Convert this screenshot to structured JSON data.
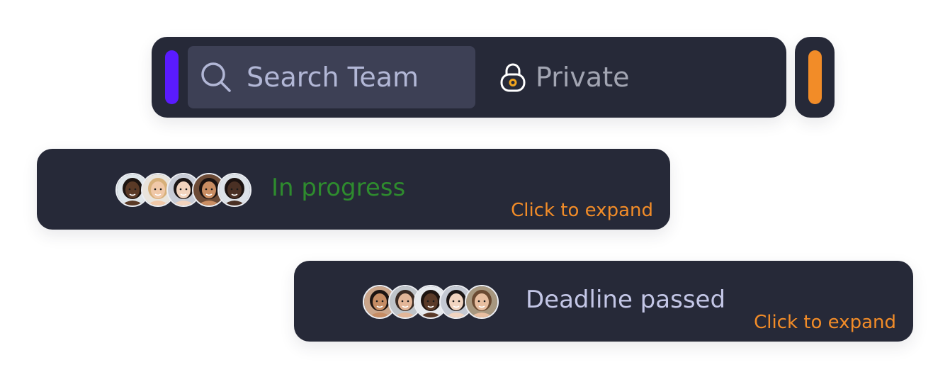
{
  "search_bar": {
    "placeholder": "Search Team",
    "privacy_label": "Private",
    "left_accent_color": "#5a1bff",
    "right_accent_color": "#f28c28",
    "icon": "search-icon",
    "privacy_icon": "lock-icon"
  },
  "tasks": [
    {
      "status": "In progress",
      "status_color": "#2e8b2e",
      "expand_label": "Click to expand",
      "expand_color": "#f28c28",
      "avatars": [
        {
          "skin": "#5a3a26",
          "hair": "#1c1410",
          "bg": "#dfe6ea"
        },
        {
          "skin": "#f0c8a8",
          "hair": "#d7b07a",
          "bg": "#e9e4dc"
        },
        {
          "skin": "#f2d3bd",
          "hair": "#1b1515",
          "bg": "#c8ccd6"
        },
        {
          "skin": "#c98d62",
          "hair": "#1a1210",
          "bg": "#6d4b36"
        },
        {
          "skin": "#4a3024",
          "hair": "#1b1210",
          "bg": "#dde2e8"
        }
      ]
    },
    {
      "status": "Deadline passed",
      "status_color": "#c3c6e6",
      "expand_label": "Click to expand",
      "expand_color": "#f28c28",
      "avatars": [
        {
          "skin": "#c58c64",
          "hair": "#1c1412",
          "bg": "#caa58a"
        },
        {
          "skin": "#e3b698",
          "hair": "#3a2a22",
          "bg": "#bfc4c9"
        },
        {
          "skin": "#5a3a28",
          "hair": "#1e1410",
          "bg": "#e7eaee"
        },
        {
          "skin": "#f1d4c0",
          "hair": "#1b1616",
          "bg": "#c4c9d3"
        },
        {
          "skin": "#e8bea0",
          "hair": "#6b4a32",
          "bg": "#a7977f"
        }
      ]
    }
  ]
}
